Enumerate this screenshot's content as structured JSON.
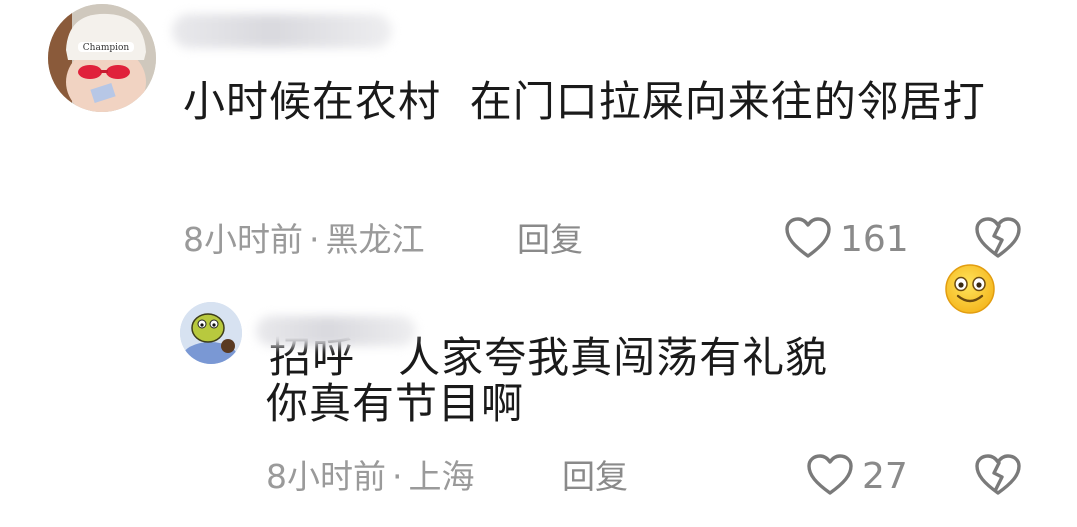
{
  "comments": [
    {
      "text_line1": "小时候在农村  在门口拉屎向来往的邻居打",
      "text_line2": "招呼   人家夸我真闯荡有礼貌",
      "emoji": "smiling-face-emoji",
      "time": "8小时前",
      "dot": "·",
      "location": "黑龙江",
      "reply_label": "回复",
      "likes": "161"
    },
    {
      "text": "你真有节目啊",
      "time": "8小时前",
      "dot": "·",
      "location": "上海",
      "reply_label": "回复",
      "likes": "27"
    }
  ],
  "colors": {
    "text": "#1a1a1a",
    "meta": "#9a9a9a",
    "icon": "#7a7a7a"
  }
}
